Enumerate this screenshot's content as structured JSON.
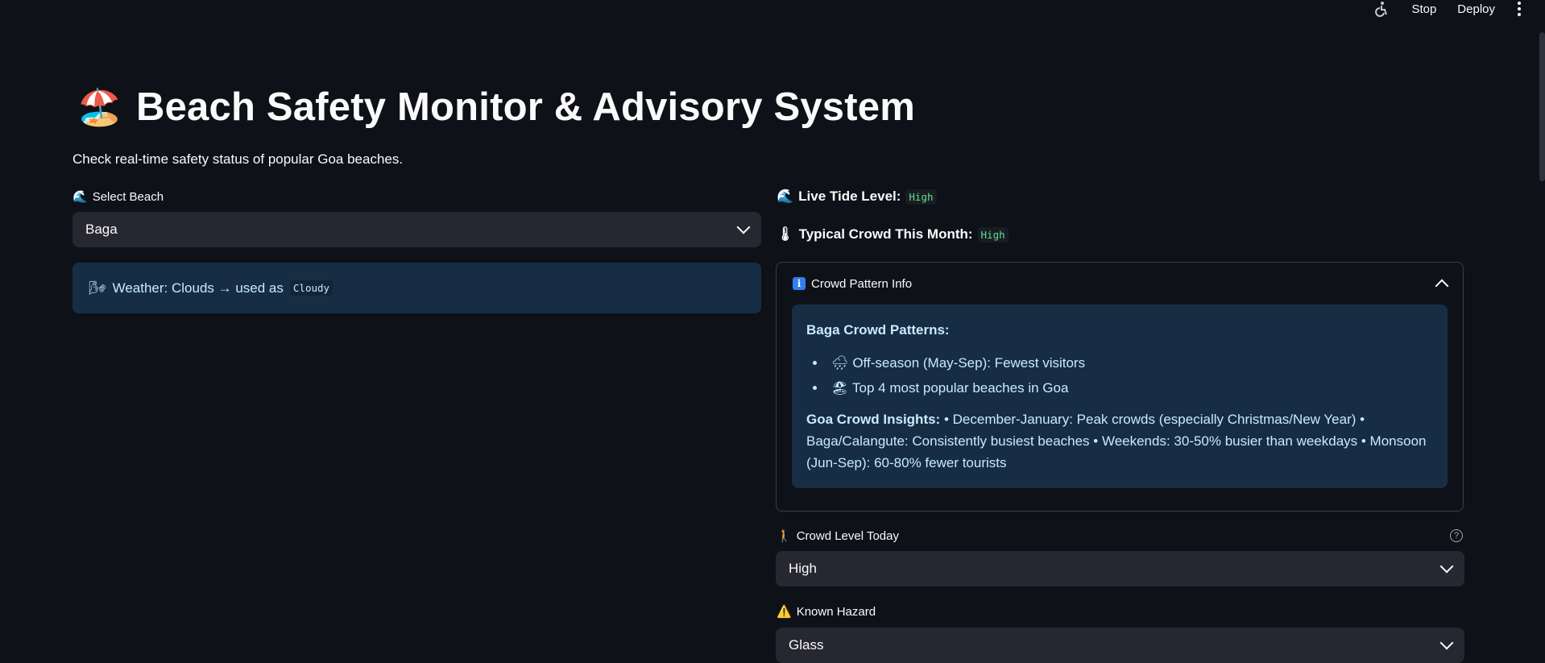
{
  "toolbar": {
    "accessibility_icon": "wheelchair-icon",
    "stop_label": "Stop",
    "deploy_label": "Deploy",
    "menu_icon": "vertical-dots-icon"
  },
  "header": {
    "title_emoji": "🏖️",
    "title": "Beach Safety Monitor & Advisory System",
    "subtitle": "Check real-time safety status of popular Goa beaches."
  },
  "beach_select": {
    "emoji": "🌊",
    "label": "Select Beach",
    "value": "Baga"
  },
  "weather": {
    "emoji": "🌬",
    "text": "Weather: Clouds → used as",
    "code": "Cloudy"
  },
  "tide": {
    "emoji": "🌊",
    "label": "Live Tide Level:",
    "value": "High"
  },
  "typical_crowd": {
    "emoji": "🌡",
    "label": "Typical Crowd This Month:",
    "value": "High"
  },
  "crowd_info": {
    "expander_title": "Crowd Pattern Info",
    "heading": "Baga Crowd Patterns:",
    "bullets": [
      {
        "emoji": "🌧",
        "text": "Off-season (May-Sep): Fewest visitors"
      },
      {
        "emoji": "🏖",
        "text": "Top 4 most popular beaches in Goa"
      }
    ],
    "insights_label": "Goa Crowd Insights:",
    "insights_text": "• December-January: Peak crowds (especially Christmas/New Year) • Baga/Calangute: Consistently busiest beaches • Weekends: 30-50% busier than weekdays • Monsoon (Jun-Sep): 60-80% fewer tourists"
  },
  "crowd_today": {
    "emoji": "🚶",
    "label": "Crowd Level Today",
    "help": "?",
    "value": "High"
  },
  "hazard": {
    "emoji": "⚠️",
    "label": "Known Hazard",
    "value": "Glass"
  },
  "colors": {
    "background": "#0e1117",
    "input_bg": "#262730",
    "info_bg": "#172d43",
    "info_text": "#c7ebff",
    "code_green": "#5ce488"
  }
}
